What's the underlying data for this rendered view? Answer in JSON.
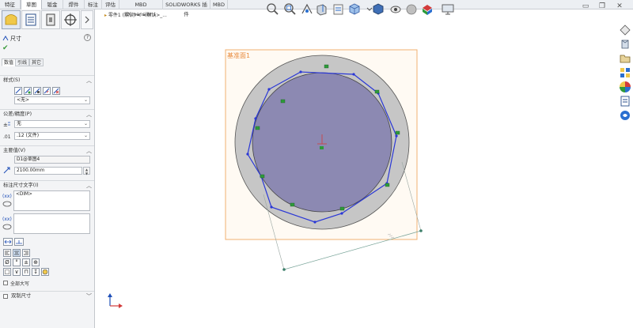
{
  "command_tabs": [
    "特征",
    "草图",
    "钣金",
    "焊件",
    "标注",
    "评估",
    "MBD Dimensions",
    "SOLIDWORKS 插件",
    "MBD"
  ],
  "command_tab_active": 1,
  "breadcrumb": "零件1 (默认) < <默认>_...",
  "property_manager": {
    "title": "尺寸",
    "ok_symbol": "✔",
    "help_symbol": "?",
    "subtabs": [
      "数值",
      "引线",
      "其它"
    ],
    "style_section": {
      "header": "样式(S)",
      "dropdown_value": "<无>"
    },
    "tolerance_section": {
      "header": "公差/精度(P)",
      "tolerance_value": "无",
      "precision_value": ".12 (文件)"
    },
    "primary_value_section": {
      "header": "主要值(V)",
      "dimension_name": "D1@草图4",
      "dimension_value": "2100.00mm"
    },
    "dimension_text_section": {
      "header": "标注尺寸文字(I)",
      "text_value": "<DIM>"
    },
    "symbols": [
      "Ø",
      "°",
      "±",
      "⊕",
      "□",
      "∨",
      "⊓",
      "↧"
    ],
    "checkbox_label": "全部大写",
    "dual_dimension_label": "双制尺寸"
  },
  "sketch": {
    "plane_label": "基准面1"
  },
  "icons": {
    "property_manager_tab": "dimension-icon",
    "feature_tree_tab": "feature-manager-icon",
    "config_tab": "configuration-manager-icon",
    "display_tab": "dimxpert-icon"
  },
  "colors": {
    "accent": "#1f4fb8",
    "plane_border": "#f0b070",
    "plane_label": "#e88a3c",
    "disk_gray": "#c6c6c6",
    "disk_fill": "#8c89b2",
    "sketch_blue": "#2a37d6",
    "relation_green": "#2e9a3a"
  }
}
